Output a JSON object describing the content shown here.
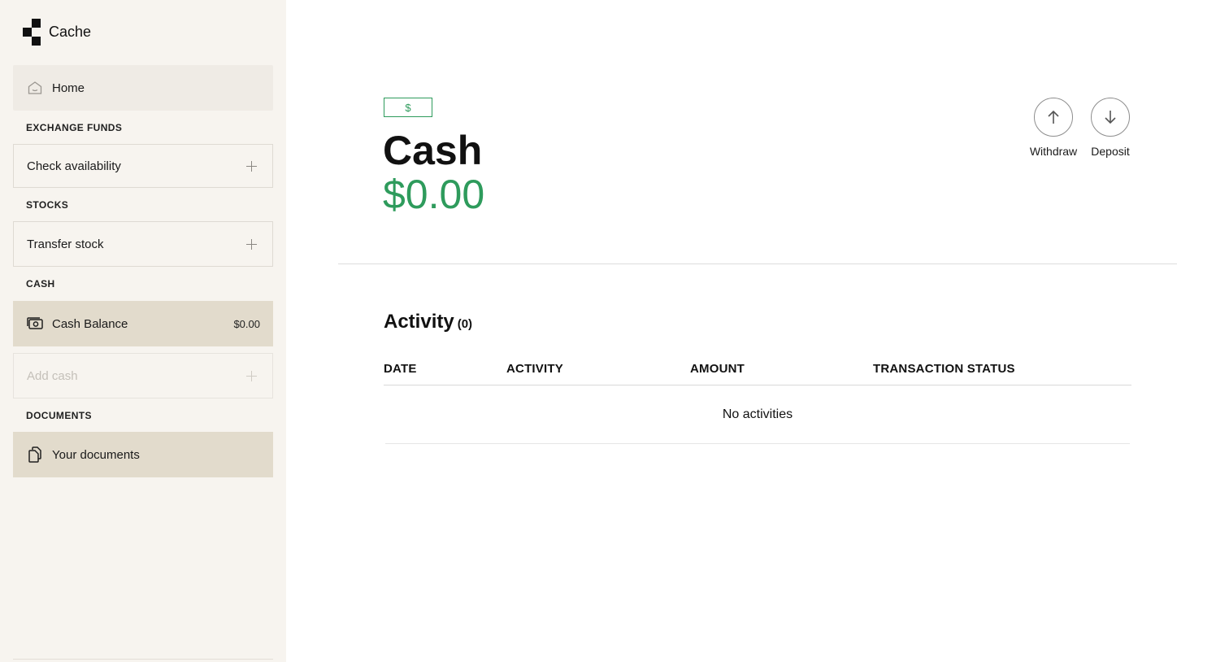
{
  "app": {
    "name": "Cache"
  },
  "sidebar": {
    "home_label": "Home",
    "sections": {
      "exchange_funds": "EXCHANGE FUNDS",
      "stocks": "STOCKS",
      "cash": "CASH",
      "documents": "DOCUMENTS"
    },
    "check_availability": "Check availability",
    "transfer_stock": "Transfer stock",
    "cash_balance": {
      "label": "Cash Balance",
      "value": "$0.00"
    },
    "add_cash": "Add cash",
    "your_documents": "Your documents"
  },
  "main": {
    "currency_badge": "$",
    "title": "Cash",
    "balance": "$0.00",
    "actions": {
      "withdraw": "Withdraw",
      "deposit": "Deposit"
    },
    "activity": {
      "title": "Activity",
      "count": "(0)",
      "columns": [
        "DATE",
        "ACTIVITY",
        "AMOUNT",
        "TRANSACTION STATUS"
      ],
      "empty_message": "No activities"
    }
  },
  "colors": {
    "accent_green": "#2e9b5c",
    "sidebar_bg": "#f7f4ef",
    "selected_bg": "#e2dbcc"
  }
}
